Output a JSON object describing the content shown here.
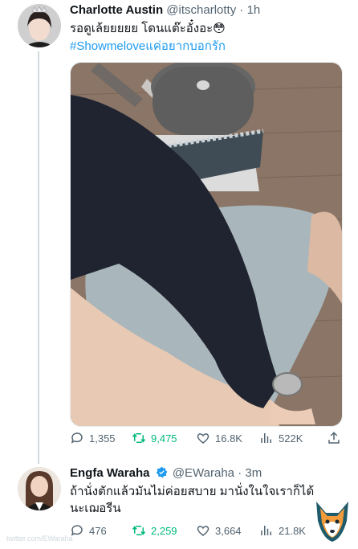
{
  "tweets": [
    {
      "name": "Charlotte Austin",
      "handle": "@itscharlotty",
      "dot": "·",
      "time": "1h",
      "text_line1": "รอดูเล้ยยยยย โดนแต๊ะอั๋งอะ😳",
      "hashtag": "#Showmeloveแค่อยากบอกรัก",
      "counts": {
        "replies": "1,355",
        "retweets": "9,475",
        "likes": "16.8K",
        "views": "522K"
      }
    },
    {
      "name": "Engfa Waraha",
      "handle": "@EWaraha",
      "dot": "·",
      "time": "3m",
      "text_line1": "ถ้านั่งตักแล้วมันไม่ค่อยสบาย มานั่งในใจเราก็ได้",
      "text_line2": "นะเฌอรีน",
      "counts": {
        "replies": "476",
        "retweets": "2,259",
        "likes": "3,664",
        "views": "21.8K"
      }
    }
  ],
  "watermark": "twitter.com/EWaraha",
  "icons": [
    "reply-icon",
    "retweet-icon",
    "like-icon",
    "views-icon",
    "share-icon",
    "verified-badge-icon",
    "fox-logo-icon"
  ],
  "colors": {
    "link": "#1d9bf0",
    "retweet": "#00ba7c",
    "muted": "#536471"
  }
}
